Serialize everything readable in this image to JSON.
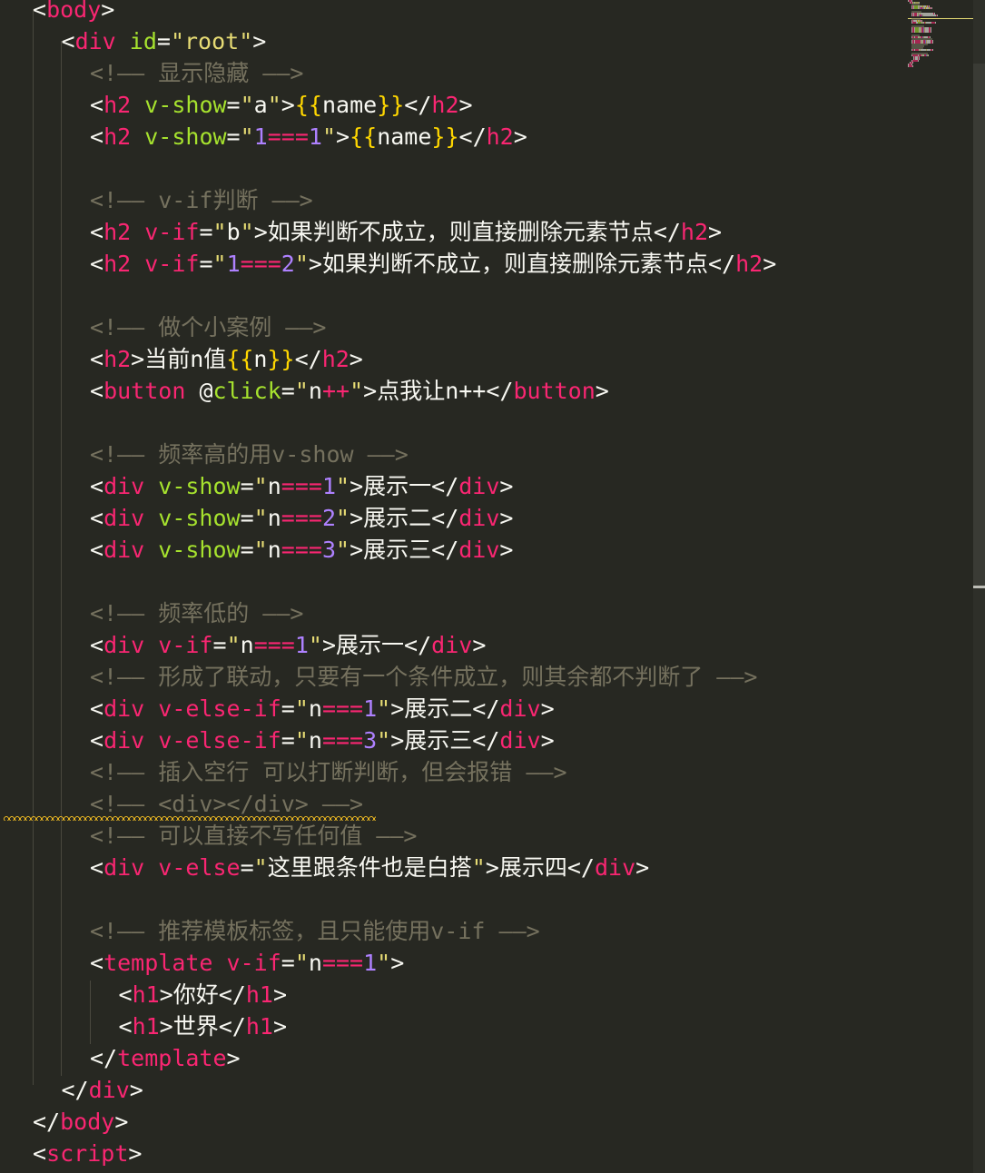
{
  "editor": {
    "lines": [
      {
        "indent": 1,
        "tokens": [
          [
            "p",
            "<"
          ],
          [
            "t",
            "body"
          ],
          [
            "p",
            ">"
          ]
        ]
      },
      {
        "indent": 2,
        "tokens": [
          [
            "p",
            "<"
          ],
          [
            "t",
            "div"
          ],
          [
            "x",
            " "
          ],
          [
            "a",
            "id"
          ],
          [
            "p",
            "="
          ],
          [
            "s",
            "\"root\""
          ],
          [
            "p",
            ">"
          ]
        ]
      },
      {
        "indent": 3,
        "tokens": [
          [
            "c",
            "<!—— 显示隐藏 ——>"
          ]
        ]
      },
      {
        "indent": 3,
        "tokens": [
          [
            "p",
            "<"
          ],
          [
            "t",
            "h2"
          ],
          [
            "x",
            " "
          ],
          [
            "a",
            "v-show"
          ],
          [
            "p",
            "="
          ],
          [
            "s",
            "\""
          ],
          [
            "x",
            "a"
          ],
          [
            "s",
            "\""
          ],
          [
            "p",
            ">"
          ],
          [
            "m",
            "{{"
          ],
          [
            "x",
            "name"
          ],
          [
            "m",
            "}}"
          ],
          [
            "p",
            "</"
          ],
          [
            "t",
            "h2"
          ],
          [
            "p",
            ">"
          ]
        ]
      },
      {
        "indent": 3,
        "tokens": [
          [
            "p",
            "<"
          ],
          [
            "t",
            "h2"
          ],
          [
            "x",
            " "
          ],
          [
            "a",
            "v-show"
          ],
          [
            "p",
            "="
          ],
          [
            "s",
            "\""
          ],
          [
            "n",
            "1"
          ],
          [
            "o",
            "==="
          ],
          [
            "n",
            "1"
          ],
          [
            "s",
            "\""
          ],
          [
            "p",
            ">"
          ],
          [
            "m",
            "{{"
          ],
          [
            "x",
            "name"
          ],
          [
            "m",
            "}}"
          ],
          [
            "p",
            "</"
          ],
          [
            "t",
            "h2"
          ],
          [
            "p",
            ">"
          ]
        ]
      },
      {
        "indent": 3,
        "tokens": []
      },
      {
        "indent": 3,
        "tokens": [
          [
            "c",
            "<!—— v-if判断 ——>"
          ]
        ]
      },
      {
        "indent": 3,
        "tokens": [
          [
            "p",
            "<"
          ],
          [
            "t",
            "h2"
          ],
          [
            "x",
            " "
          ],
          [
            "t",
            "v-if"
          ],
          [
            "p",
            "="
          ],
          [
            "s",
            "\""
          ],
          [
            "x",
            "b"
          ],
          [
            "s",
            "\""
          ],
          [
            "p",
            ">"
          ],
          [
            "x",
            "如果判断不成立，则直接删除元素节点"
          ],
          [
            "p",
            "</"
          ],
          [
            "t",
            "h2"
          ],
          [
            "p",
            ">"
          ]
        ]
      },
      {
        "indent": 3,
        "tokens": [
          [
            "p",
            "<"
          ],
          [
            "t",
            "h2"
          ],
          [
            "x",
            " "
          ],
          [
            "t",
            "v-if"
          ],
          [
            "p",
            "="
          ],
          [
            "s",
            "\""
          ],
          [
            "n",
            "1"
          ],
          [
            "o",
            "==="
          ],
          [
            "n",
            "2"
          ],
          [
            "s",
            "\""
          ],
          [
            "p",
            ">"
          ],
          [
            "x",
            "如果判断不成立，则直接删除元素节点"
          ],
          [
            "p",
            "</"
          ],
          [
            "t",
            "h2"
          ],
          [
            "p",
            ">"
          ]
        ]
      },
      {
        "indent": 3,
        "tokens": []
      },
      {
        "indent": 3,
        "tokens": [
          [
            "c",
            "<!—— 做个小案例 ——>"
          ]
        ]
      },
      {
        "indent": 3,
        "tokens": [
          [
            "p",
            "<"
          ],
          [
            "t",
            "h2"
          ],
          [
            "p",
            ">"
          ],
          [
            "x",
            "当前n值"
          ],
          [
            "m",
            "{{"
          ],
          [
            "x",
            "n"
          ],
          [
            "m",
            "}}"
          ],
          [
            "p",
            "</"
          ],
          [
            "t",
            "h2"
          ],
          [
            "p",
            ">"
          ]
        ]
      },
      {
        "indent": 3,
        "tokens": [
          [
            "p",
            "<"
          ],
          [
            "t",
            "button"
          ],
          [
            "x",
            " "
          ],
          [
            "p",
            "@"
          ],
          [
            "a",
            "click"
          ],
          [
            "p",
            "="
          ],
          [
            "s",
            "\""
          ],
          [
            "x",
            "n"
          ],
          [
            "o",
            "++"
          ],
          [
            "s",
            "\""
          ],
          [
            "p",
            ">"
          ],
          [
            "x",
            "点我让n++"
          ],
          [
            "p",
            "</"
          ],
          [
            "t",
            "button"
          ],
          [
            "p",
            ">"
          ]
        ]
      },
      {
        "indent": 3,
        "tokens": []
      },
      {
        "indent": 3,
        "tokens": [
          [
            "c",
            "<!—— 频率高的用v-show ——>"
          ]
        ]
      },
      {
        "indent": 3,
        "tokens": [
          [
            "p",
            "<"
          ],
          [
            "t",
            "div"
          ],
          [
            "x",
            " "
          ],
          [
            "a",
            "v-show"
          ],
          [
            "p",
            "="
          ],
          [
            "s",
            "\""
          ],
          [
            "x",
            "n"
          ],
          [
            "o",
            "==="
          ],
          [
            "n",
            "1"
          ],
          [
            "s",
            "\""
          ],
          [
            "p",
            ">"
          ],
          [
            "x",
            "展示一"
          ],
          [
            "p",
            "</"
          ],
          [
            "t",
            "div"
          ],
          [
            "p",
            ">"
          ]
        ]
      },
      {
        "indent": 3,
        "tokens": [
          [
            "p",
            "<"
          ],
          [
            "t",
            "div"
          ],
          [
            "x",
            " "
          ],
          [
            "a",
            "v-show"
          ],
          [
            "p",
            "="
          ],
          [
            "s",
            "\""
          ],
          [
            "x",
            "n"
          ],
          [
            "o",
            "==="
          ],
          [
            "n",
            "2"
          ],
          [
            "s",
            "\""
          ],
          [
            "p",
            ">"
          ],
          [
            "x",
            "展示二"
          ],
          [
            "p",
            "</"
          ],
          [
            "t",
            "div"
          ],
          [
            "p",
            ">"
          ]
        ]
      },
      {
        "indent": 3,
        "tokens": [
          [
            "p",
            "<"
          ],
          [
            "t",
            "div"
          ],
          [
            "x",
            " "
          ],
          [
            "a",
            "v-show"
          ],
          [
            "p",
            "="
          ],
          [
            "s",
            "\""
          ],
          [
            "x",
            "n"
          ],
          [
            "o",
            "==="
          ],
          [
            "n",
            "3"
          ],
          [
            "s",
            "\""
          ],
          [
            "p",
            ">"
          ],
          [
            "x",
            "展示三"
          ],
          [
            "p",
            "</"
          ],
          [
            "t",
            "div"
          ],
          [
            "p",
            ">"
          ]
        ]
      },
      {
        "indent": 3,
        "tokens": []
      },
      {
        "indent": 3,
        "tokens": [
          [
            "c",
            "<!—— 频率低的 ——>"
          ]
        ]
      },
      {
        "indent": 3,
        "tokens": [
          [
            "p",
            "<"
          ],
          [
            "t",
            "div"
          ],
          [
            "x",
            " "
          ],
          [
            "t",
            "v-if"
          ],
          [
            "p",
            "="
          ],
          [
            "s",
            "\""
          ],
          [
            "x",
            "n"
          ],
          [
            "o",
            "==="
          ],
          [
            "n",
            "1"
          ],
          [
            "s",
            "\""
          ],
          [
            "p",
            ">"
          ],
          [
            "x",
            "展示一"
          ],
          [
            "p",
            "</"
          ],
          [
            "t",
            "div"
          ],
          [
            "p",
            ">"
          ]
        ]
      },
      {
        "indent": 3,
        "tokens": [
          [
            "c",
            "<!—— 形成了联动，只要有一个条件成立，则其余都不判断了 ——>"
          ]
        ]
      },
      {
        "indent": 3,
        "tokens": [
          [
            "p",
            "<"
          ],
          [
            "t",
            "div"
          ],
          [
            "x",
            " "
          ],
          [
            "t",
            "v-else-if"
          ],
          [
            "p",
            "="
          ],
          [
            "s",
            "\""
          ],
          [
            "x",
            "n"
          ],
          [
            "o",
            "==="
          ],
          [
            "n",
            "1"
          ],
          [
            "s",
            "\""
          ],
          [
            "p",
            ">"
          ],
          [
            "x",
            "展示二"
          ],
          [
            "p",
            "</"
          ],
          [
            "t",
            "div"
          ],
          [
            "p",
            ">"
          ]
        ]
      },
      {
        "indent": 3,
        "tokens": [
          [
            "p",
            "<"
          ],
          [
            "t",
            "div"
          ],
          [
            "x",
            " "
          ],
          [
            "t",
            "v-else-if"
          ],
          [
            "p",
            "="
          ],
          [
            "s",
            "\""
          ],
          [
            "x",
            "n"
          ],
          [
            "o",
            "==="
          ],
          [
            "n",
            "3"
          ],
          [
            "s",
            "\""
          ],
          [
            "p",
            ">"
          ],
          [
            "x",
            "展示三"
          ],
          [
            "p",
            "</"
          ],
          [
            "t",
            "div"
          ],
          [
            "p",
            ">"
          ]
        ]
      },
      {
        "indent": 3,
        "tokens": [
          [
            "c",
            "<!—— 插入空行 可以打断判断，但会报错 ——>"
          ]
        ]
      },
      {
        "indent": 3,
        "tokens": [
          [
            "c",
            "<!—— <div></div> ——>"
          ]
        ]
      },
      {
        "indent": 3,
        "tokens": [
          [
            "c",
            "<!—— 可以直接不写任何值 ——>"
          ]
        ]
      },
      {
        "indent": 3,
        "tokens": [
          [
            "p",
            "<"
          ],
          [
            "t",
            "div"
          ],
          [
            "x",
            " "
          ],
          [
            "t",
            "v-else"
          ],
          [
            "p",
            "="
          ],
          [
            "s",
            "\""
          ],
          [
            "x",
            "这里跟条件也是白搭"
          ],
          [
            "s",
            "\""
          ],
          [
            "p",
            ">"
          ],
          [
            "x",
            "展示四"
          ],
          [
            "p",
            "</"
          ],
          [
            "t",
            "div"
          ],
          [
            "p",
            ">"
          ]
        ]
      },
      {
        "indent": 3,
        "tokens": []
      },
      {
        "indent": 3,
        "tokens": [
          [
            "c",
            "<!—— 推荐模板标签，且只能使用v-if ——>"
          ]
        ]
      },
      {
        "indent": 3,
        "tokens": [
          [
            "p",
            "<"
          ],
          [
            "t",
            "template"
          ],
          [
            "x",
            " "
          ],
          [
            "t",
            "v-if"
          ],
          [
            "p",
            "="
          ],
          [
            "s",
            "\""
          ],
          [
            "x",
            "n"
          ],
          [
            "o",
            "==="
          ],
          [
            "n",
            "1"
          ],
          [
            "s",
            "\""
          ],
          [
            "p",
            ">"
          ]
        ]
      },
      {
        "indent": 4,
        "tokens": [
          [
            "p",
            "<"
          ],
          [
            "t",
            "h1"
          ],
          [
            "p",
            ">"
          ],
          [
            "x",
            "你好"
          ],
          [
            "p",
            "</"
          ],
          [
            "t",
            "h1"
          ],
          [
            "p",
            ">"
          ]
        ]
      },
      {
        "indent": 4,
        "tokens": [
          [
            "p",
            "<"
          ],
          [
            "t",
            "h1"
          ],
          [
            "p",
            ">"
          ],
          [
            "x",
            "世界"
          ],
          [
            "p",
            "</"
          ],
          [
            "t",
            "h1"
          ],
          [
            "p",
            ">"
          ]
        ]
      },
      {
        "indent": 3,
        "tokens": [
          [
            "p",
            "</"
          ],
          [
            "t",
            "template"
          ],
          [
            "p",
            ">"
          ]
        ]
      },
      {
        "indent": 2,
        "tokens": [
          [
            "p",
            "</"
          ],
          [
            "t",
            "div"
          ],
          [
            "p",
            ">"
          ]
        ]
      },
      {
        "indent": 1,
        "tokens": [
          [
            "p",
            "</"
          ],
          [
            "t",
            "body"
          ],
          [
            "p",
            ">"
          ]
        ]
      },
      {
        "indent": 1,
        "tokens": [
          [
            "p",
            "<"
          ],
          [
            "t",
            "script"
          ],
          [
            "p",
            ">"
          ]
        ]
      }
    ]
  },
  "colors": {
    "background": "#272822",
    "tag": "#F92672",
    "attribute": "#A6E22E",
    "string": "#E6DB74",
    "number": "#AE81FF",
    "comment": "#75715E",
    "text": "#F8F8F2",
    "mustache": "#FFD700"
  },
  "lint_warning_line": 26
}
